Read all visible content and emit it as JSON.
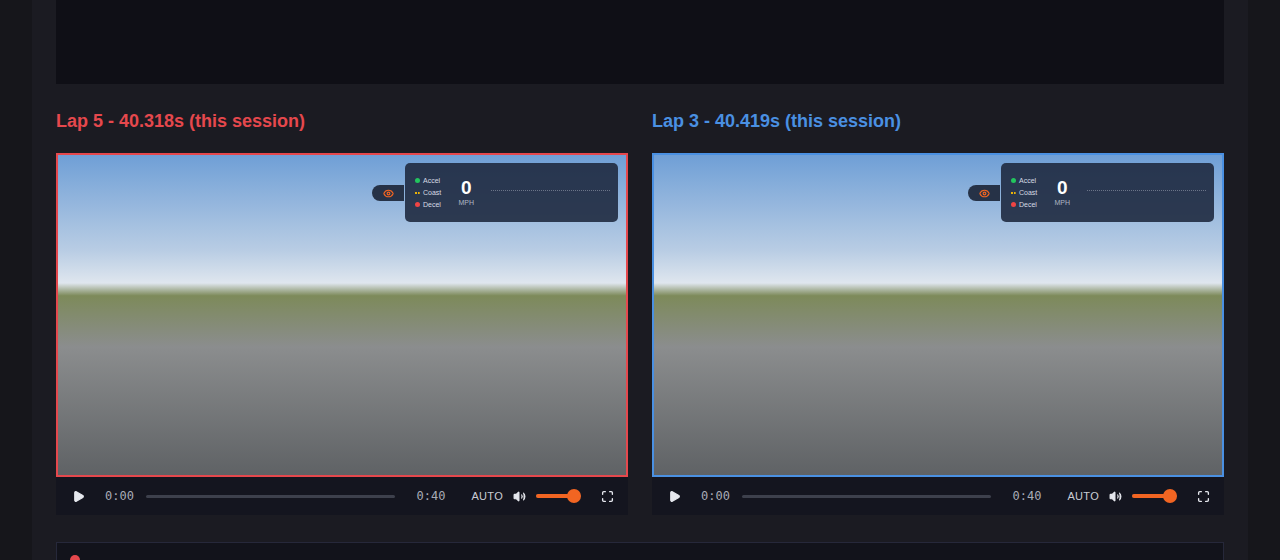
{
  "laps": [
    {
      "title": "Lap 5 - 40.318s (this session)",
      "color": "#e5484d",
      "hud": {
        "legend": [
          {
            "label": "Accel",
            "kind": "dot",
            "color": "#22c55e"
          },
          {
            "label": "Coast",
            "kind": "dash",
            "color": "#eab308"
          },
          {
            "label": "Decel",
            "kind": "dot",
            "color": "#ef4444"
          }
        ],
        "speed": "0",
        "unit": "MPH"
      },
      "player": {
        "playing": false,
        "current": "0:00",
        "duration": "0:40",
        "progress": 0,
        "quality": "AUTO",
        "muted": false,
        "volume": 0.85
      }
    },
    {
      "title": "Lap 3 - 40.419s (this session)",
      "color": "#4a90e2",
      "hud": {
        "legend": [
          {
            "label": "Accel",
            "kind": "dot",
            "color": "#22c55e"
          },
          {
            "label": "Coast",
            "kind": "dash",
            "color": "#eab308"
          },
          {
            "label": "Decel",
            "kind": "dot",
            "color": "#ef4444"
          }
        ],
        "speed": "0",
        "unit": "MPH"
      },
      "player": {
        "playing": false,
        "current": "0:00",
        "duration": "0:40",
        "progress": 0,
        "quality": "AUTO",
        "muted": false,
        "volume": 0.85
      }
    }
  ]
}
